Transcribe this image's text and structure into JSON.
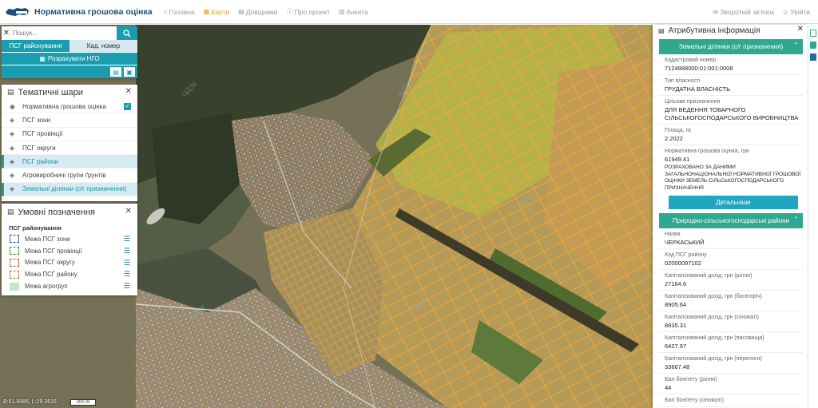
{
  "header": {
    "title": "Нормативна грошова оцінка",
    "nav": [
      {
        "label": "Головна",
        "icon": "home-icon"
      },
      {
        "label": "Карти",
        "icon": "map-icon"
      },
      {
        "label": "Довідники",
        "icon": "book-icon"
      },
      {
        "label": "Про проект",
        "icon": "info-icon"
      },
      {
        "label": "Анкета",
        "icon": "trash-icon"
      }
    ],
    "right_nav": [
      {
        "label": "Зворотній зв'язок",
        "icon": "chat-icon"
      },
      {
        "label": "Увійти",
        "icon": "user-icon"
      }
    ],
    "active_nav": "Карти"
  },
  "search": {
    "placeholder": "Пошук...",
    "tabs": [
      "ПСГ районування",
      "Кад. номер"
    ],
    "active_tab": "ПСГ районування",
    "calc_button": "Розрахувати НГО"
  },
  "layers_panel": {
    "title": "Тематичні шари",
    "items": [
      {
        "label": "Нормативна грошова оцінка",
        "icon": "globe-icon",
        "checked": true
      },
      {
        "label": "ПСГ зони",
        "icon": "layers-icon"
      },
      {
        "label": "ПСГ провінції",
        "icon": "layers-icon"
      },
      {
        "label": "ПСГ округи",
        "icon": "layers-icon"
      },
      {
        "label": "ПСГ райони",
        "icon": "layers-icon",
        "selected": true
      },
      {
        "label": "Агровиробничі групи ґрунтів",
        "icon": "layers-icon"
      },
      {
        "label": "Земельні ділянки (с/г призначення)",
        "icon": "layers-icon",
        "selected": true
      }
    ]
  },
  "legend_panel": {
    "title": "Умовні позначення",
    "group_title": "ПСГ районування",
    "items": [
      {
        "label": "Межа ПСГ зони",
        "color": "#1b4fb5",
        "style": "dashed"
      },
      {
        "label": "Межа ПСГ провінції",
        "color": "#2e9a3a",
        "style": "dashed"
      },
      {
        "label": "Межа ПСГ округу",
        "color": "#d2541f",
        "style": "dashed"
      },
      {
        "label": "Межа ПСГ району",
        "color": "#b0782a",
        "style": "dashed"
      },
      {
        "label": "Межа агрогруп",
        "color": "#a9e2b0",
        "style": "fill"
      }
    ]
  },
  "attributes": {
    "title": "Атрибутивна інформація",
    "section1": "Земельні ділянки (с/г призначення)",
    "fields": [
      {
        "label": "Кадастровий номер",
        "value": "7124988000:01:001:0008"
      },
      {
        "label": "Тип власності",
        "value": "ГРУДАТНА ВЛАСНІСТЬ"
      },
      {
        "label": "Цільове призначення",
        "value": "ДЛЯ ВЕДЕННЯ ТОВАРНОГО СІЛЬСЬКОГОСПОДАРСЬКОГО ВИРОБНИЦТВА"
      },
      {
        "label": "Площа, га",
        "value": "2.2022"
      },
      {
        "label": "Нормативна грошова оцінка, грн",
        "value": "61949.41",
        "note": "РОЗРАХОВАНО ЗА ДАНИМИ ЗАГАЛЬНОНАЦІОНАЛЬНОЇ НОРМАТИВНОЇ ГРОШОВОЇ ОЦІНКИ ЗЕМЕЛЬ СІЛЬСЬКОГОСПОДАРСЬКОГО ПРИЗНАЧЕННЯ"
      }
    ],
    "detail_button": "Детальніше",
    "section2": "Природно-сільськогосподарські райони",
    "fields2": [
      {
        "label": "Назва",
        "value": "ЧЕРКАСЬКИЙ"
      },
      {
        "label": "Код ПСГ району",
        "value": "02000097102"
      },
      {
        "label": "Капіталізований дохід, грн (рілля)",
        "value": "27164.6"
      },
      {
        "label": "Капіталізований дохід, грн (багаторіч)",
        "value": "8905.64"
      },
      {
        "label": "Капіталізований дохід, грн (сіножаті)",
        "value": "8935.31"
      },
      {
        "label": "Капіталізований дохід, грн (пасовища)",
        "value": "6427.97"
      },
      {
        "label": "Капіталізований дохід, грн (перелоги)",
        "value": "33667.48"
      },
      {
        "label": "Бал бонітету (рілля)",
        "value": "44"
      },
      {
        "label": "Бал бонітету (сіножаті)",
        "value": ""
      }
    ]
  },
  "map": {
    "coords": "B:51.8986, L:29.3616",
    "scale": "200 m"
  }
}
